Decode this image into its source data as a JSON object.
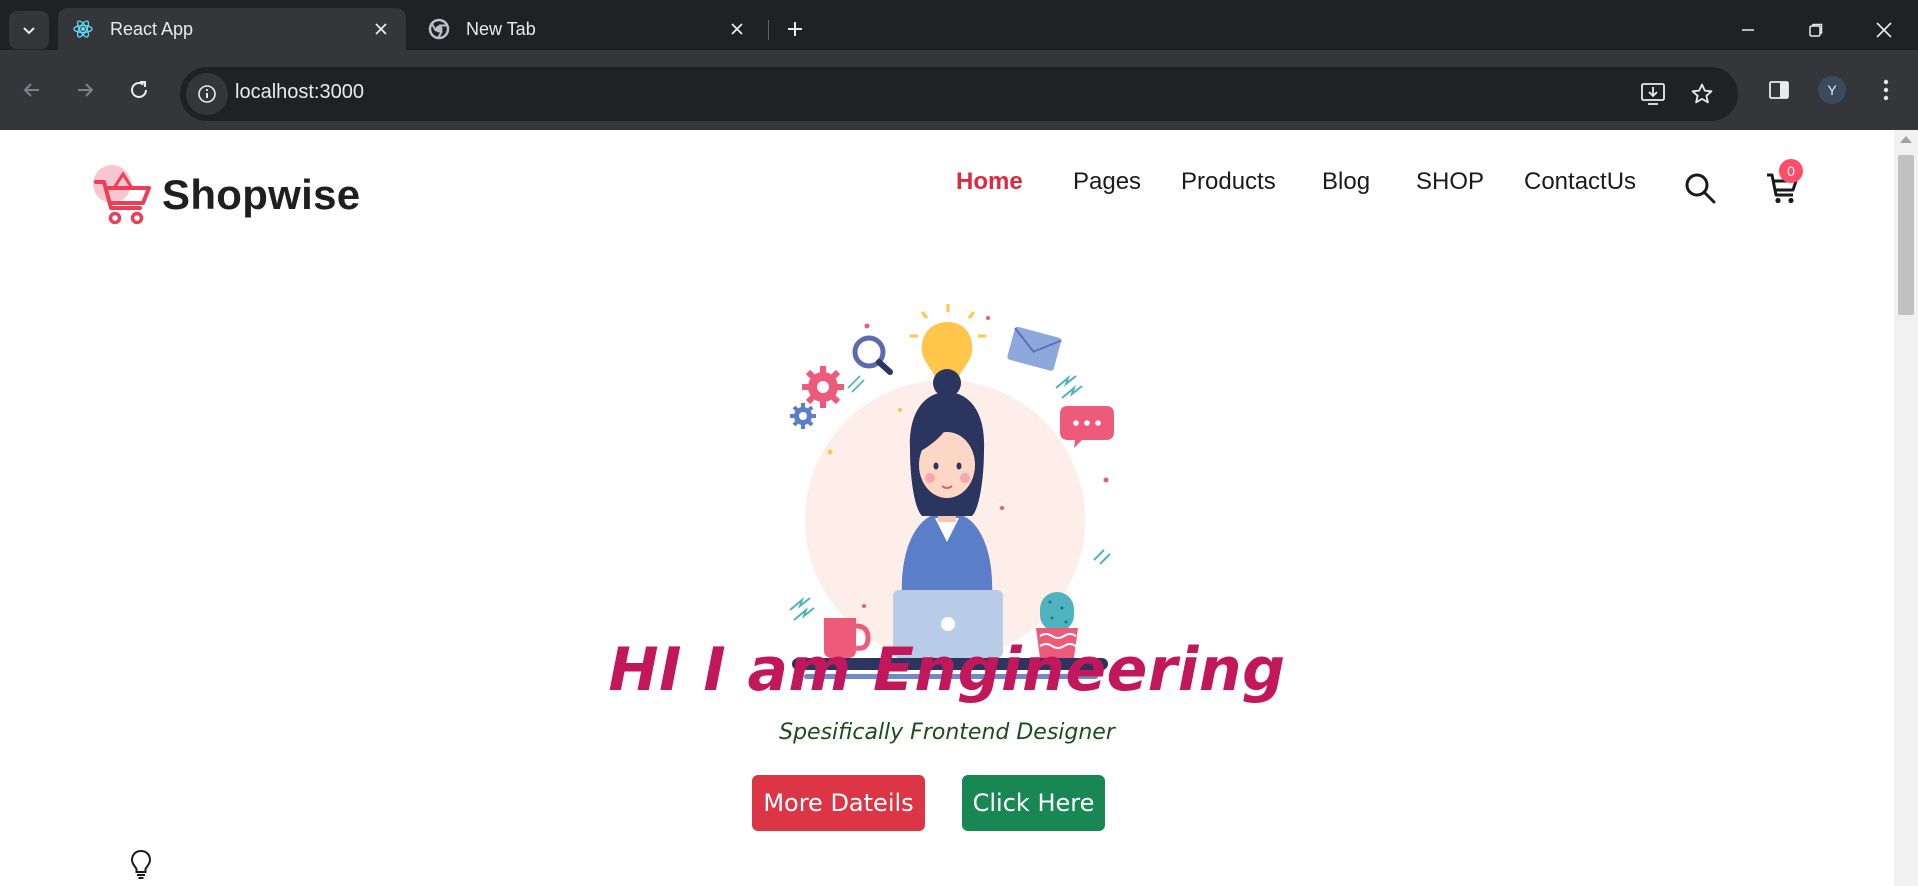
{
  "browser": {
    "tabs": [
      {
        "title": "React App",
        "icon": "react-icon",
        "active": true
      },
      {
        "title": "New Tab",
        "icon": "chrome-icon",
        "active": false
      }
    ],
    "address": "localhost:3000",
    "profile_initial": "Y"
  },
  "site": {
    "brand": "Shopwise",
    "nav": [
      {
        "label": "Home",
        "active": true
      },
      {
        "label": "Pages",
        "active": false
      },
      {
        "label": "Products",
        "active": false
      },
      {
        "label": "Blog",
        "active": false
      },
      {
        "label": "SHOP",
        "active": false
      },
      {
        "label": "ContactUs",
        "active": false
      }
    ],
    "cart_count": "0"
  },
  "hero": {
    "title": "HI I am Engineering",
    "subtitle": "Spesifically Frontend Designer",
    "primary_button": "More Dateils",
    "secondary_button": "Click Here"
  },
  "colors": {
    "accent_red": "#dc3545",
    "accent_green": "#198754",
    "title_pink": "#c2185b",
    "nav_active": "#e0293e"
  }
}
